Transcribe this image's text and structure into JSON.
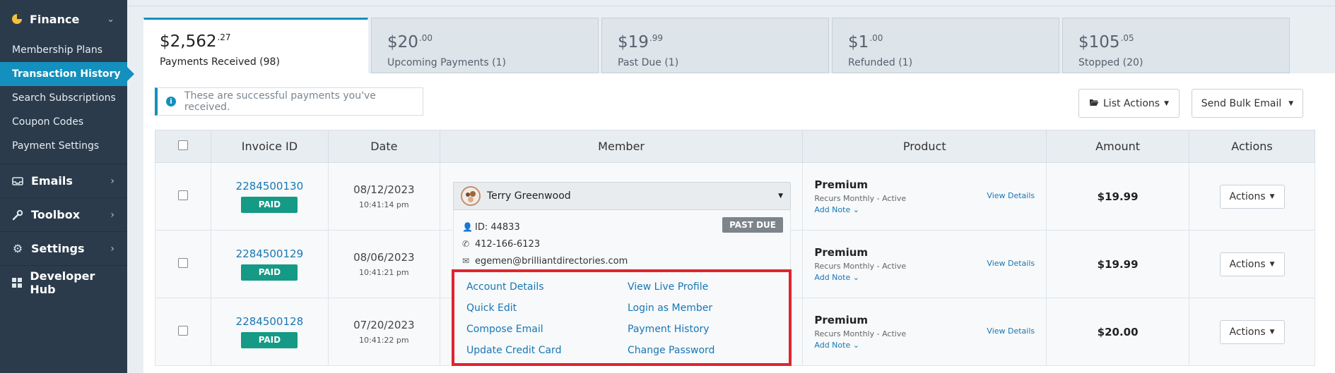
{
  "sidebar": {
    "finance_label": "Finance",
    "finance_items": [
      "Membership Plans",
      "Transaction History",
      "Search Subscriptions",
      "Coupon Codes",
      "Payment Settings"
    ],
    "groups": [
      "Emails",
      "Toolbox",
      "Settings",
      "Developer Hub"
    ]
  },
  "tabs": [
    {
      "whole": "$2,562",
      "cents": ".27",
      "label": "Payments Received (98)"
    },
    {
      "whole": "$20",
      "cents": ".00",
      "label": "Upcoming Payments (1)"
    },
    {
      "whole": "$19",
      "cents": ".99",
      "label": "Past Due (1)"
    },
    {
      "whole": "$1",
      "cents": ".00",
      "label": "Refunded (1)"
    },
    {
      "whole": "$105",
      "cents": ".05",
      "label": "Stopped (20)"
    }
  ],
  "notice": "These are successful payments you've received.",
  "buttons": {
    "list_actions": "List Actions",
    "bulk_email": "Send Bulk Email"
  },
  "table": {
    "headers": [
      "Invoice ID",
      "Date",
      "Member",
      "Product",
      "Amount",
      "Actions"
    ],
    "rows": [
      {
        "invoice": "2284500130",
        "status": "PAID",
        "date": "08/12/2023",
        "time": "10:41:14 pm",
        "product": "Premium",
        "product_status": "Recurs Monthly - Active",
        "add_note": "Add Note",
        "view": "View Details",
        "amount": "$19.99",
        "action": "Actions"
      },
      {
        "invoice": "2284500129",
        "status": "PAID",
        "date": "08/06/2023",
        "time": "10:41:21 pm",
        "product": "Premium",
        "product_status": "Recurs Monthly - Active",
        "add_note": "Add Note",
        "view": "View Details",
        "amount": "$19.99",
        "action": "Actions"
      },
      {
        "invoice": "2284500128",
        "status": "PAID",
        "date": "07/20/2023",
        "time": "10:41:22 pm",
        "product": "Premium",
        "product_status": "Recurs Monthly - Active",
        "add_note": "Add Note",
        "view": "View Details",
        "amount": "$20.00",
        "action": "Actions"
      }
    ]
  },
  "member": {
    "name": "Terry Greenwood",
    "id": "ID: 44833",
    "phone": "412-166-6123",
    "email": "egemen@brilliantdirectories.com",
    "badge": "PAST DUE",
    "links_left": [
      "Account Details",
      "Quick Edit",
      "Compose Email",
      "Update Credit Card"
    ],
    "links_right": [
      "View Live Profile",
      "Login as Member",
      "Payment History",
      "Change Password"
    ]
  },
  "colors": {
    "sidebar": "#2b3b4c",
    "accent": "#1390bd",
    "paid": "#159a86",
    "highlight": "#e0242e"
  }
}
